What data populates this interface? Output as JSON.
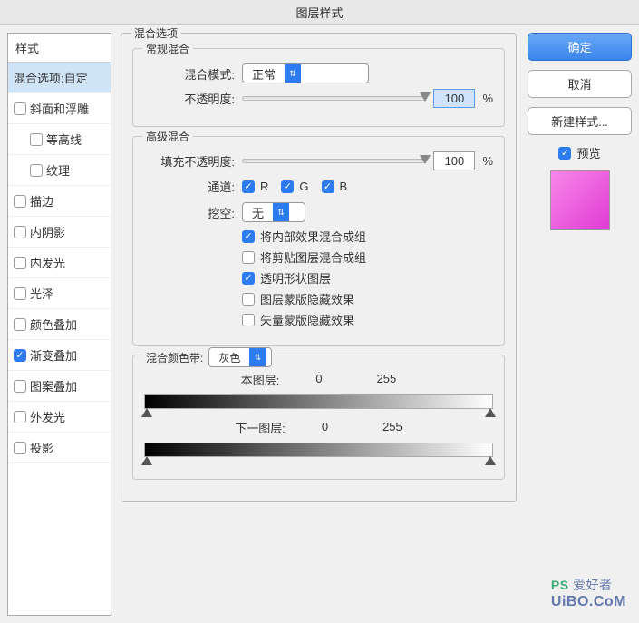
{
  "title": "图层样式",
  "sidebar": {
    "header": "样式",
    "items": [
      {
        "label": "混合选项:自定",
        "checked": null,
        "selected": true
      },
      {
        "label": "斜面和浮雕",
        "checked": false
      },
      {
        "label": "等高线",
        "checked": false,
        "sub": true
      },
      {
        "label": "纹理",
        "checked": false,
        "sub": true
      },
      {
        "label": "描边",
        "checked": false
      },
      {
        "label": "内阴影",
        "checked": false
      },
      {
        "label": "内发光",
        "checked": false
      },
      {
        "label": "光泽",
        "checked": false
      },
      {
        "label": "颜色叠加",
        "checked": false
      },
      {
        "label": "渐变叠加",
        "checked": true
      },
      {
        "label": "图案叠加",
        "checked": false
      },
      {
        "label": "外发光",
        "checked": false
      },
      {
        "label": "投影",
        "checked": false
      }
    ]
  },
  "blending": {
    "section": "混合选项",
    "general": {
      "legend": "常规混合",
      "mode_label": "混合模式:",
      "mode_value": "正常",
      "opacity_label": "不透明度:",
      "opacity_value": "100",
      "opacity_unit": "%"
    },
    "advanced": {
      "legend": "高级混合",
      "fill_label": "填充不透明度:",
      "fill_value": "100",
      "fill_unit": "%",
      "channels_label": "通道:",
      "channels": [
        "R",
        "G",
        "B"
      ],
      "knockout_label": "挖空:",
      "knockout_value": "无",
      "opts": [
        {
          "label": "将内部效果混合成组",
          "checked": true
        },
        {
          "label": "将剪贴图层混合成组",
          "checked": false
        },
        {
          "label": "透明形状图层",
          "checked": true
        },
        {
          "label": "图层蒙版隐藏效果",
          "checked": false
        },
        {
          "label": "矢量蒙版隐藏效果",
          "checked": false
        }
      ]
    },
    "blendif": {
      "legend": "混合颜色带:",
      "channel": "灰色",
      "this_label": "本图层:",
      "this_lo": "0",
      "this_hi": "255",
      "under_label": "下一图层:",
      "under_lo": "0",
      "under_hi": "255"
    }
  },
  "buttons": {
    "ok": "确定",
    "cancel": "取消",
    "new_style": "新建样式...",
    "preview": "预览"
  },
  "watermark": {
    "ps": "PS",
    "text": "爱好者",
    "url": "UiBO.CoM"
  }
}
